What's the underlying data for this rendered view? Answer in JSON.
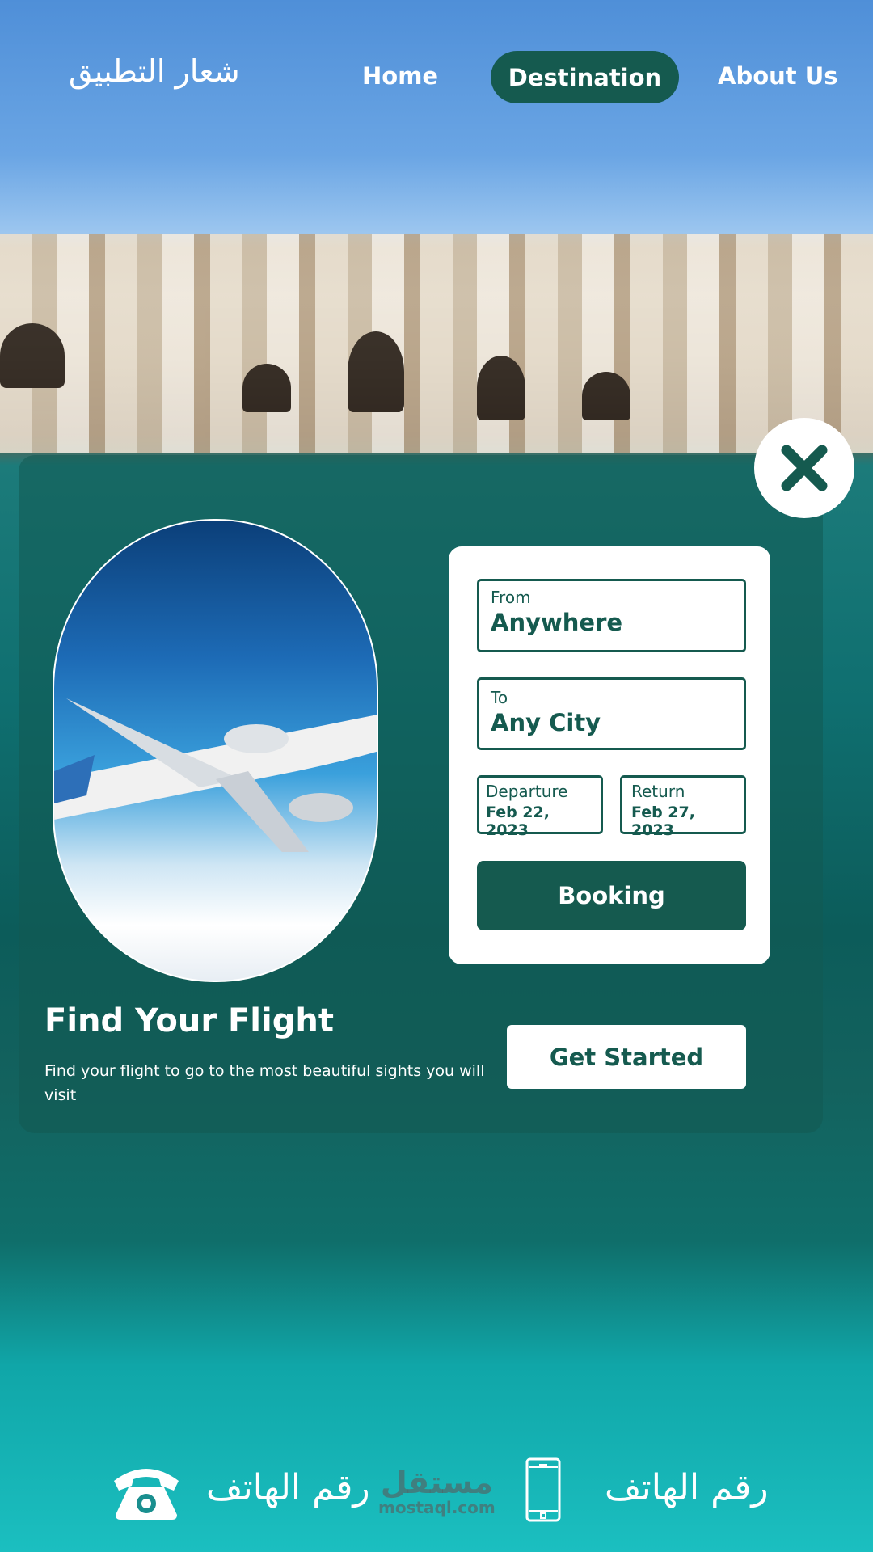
{
  "header": {
    "logo_text": "شعار التطبيق",
    "nav": [
      {
        "label": "Home"
      },
      {
        "label": "Destination",
        "active": true
      },
      {
        "label": "About Us"
      }
    ]
  },
  "colors": {
    "accent": "#155a4f",
    "card": "#ffffff"
  },
  "booking_form": {
    "from": {
      "label": "From",
      "value": "Anywhere"
    },
    "to": {
      "label": "To",
      "value": "Any City"
    },
    "departure": {
      "label": "Departure",
      "value": "Feb 22, 2023"
    },
    "return": {
      "label": "Return",
      "value": "Feb 27, 2023"
    },
    "submit_label": "Booking"
  },
  "hero": {
    "title": "Find Your Flight",
    "subtitle": "Find your flight to go to the most beautiful sights you will visit",
    "cta_label": "Get Started"
  },
  "footer": {
    "landline_label": "رقم الهاتف",
    "mobile_label": "رقم الهاتف",
    "icons": [
      "telephone-icon",
      "mobile-phone-icon"
    ]
  },
  "watermark": {
    "arabic": "مستقل",
    "latin": "mostaql.com"
  }
}
